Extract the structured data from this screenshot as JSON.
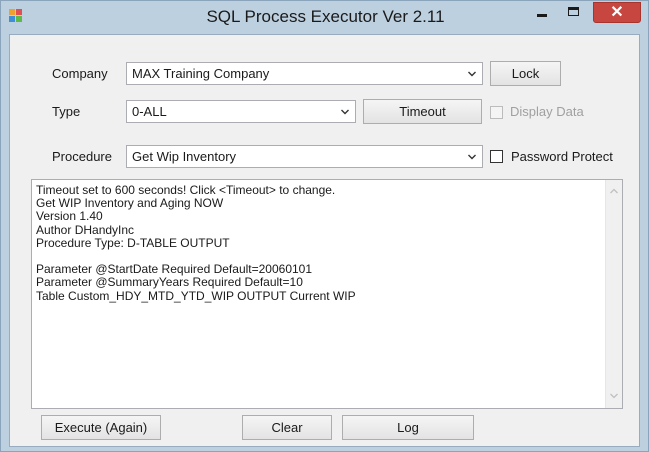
{
  "window": {
    "title": "SQL Process Executor Ver 2.11",
    "close_glyph": "✕"
  },
  "company": {
    "label": "Company",
    "value": "MAX Training Company"
  },
  "lock_button": {
    "label": "Lock"
  },
  "type": {
    "label": "Type",
    "value": "0-ALL"
  },
  "timeout_button": {
    "label": "Timeout"
  },
  "display_data": {
    "label": "Display Data",
    "checked": false,
    "enabled": false
  },
  "procedure": {
    "label": "Procedure",
    "value": "Get Wip Inventory"
  },
  "password_protect": {
    "label": "Password Protect",
    "checked": false
  },
  "output": {
    "lines": [
      "Timeout set to 600 seconds! Click <Timeout> to change.",
      "Get WIP Inventory and Aging NOW",
      "Version 1.40",
      "Author DHandyInc",
      "Procedure Type: D-TABLE OUTPUT",
      "",
      "Parameter @StartDate  Required  Default=20060101",
      "Parameter @SummaryYears  Required  Default=10",
      "Table Custom_HDY_MTD_YTD_WIP  OUTPUT  Current WIP"
    ]
  },
  "buttons": {
    "execute": "Execute (Again)",
    "clear": "Clear",
    "log": "Log"
  },
  "colors": {
    "title_bar": "#bdd0e0",
    "close_button": "#c7463f",
    "client_background": "#f0f0f0"
  }
}
